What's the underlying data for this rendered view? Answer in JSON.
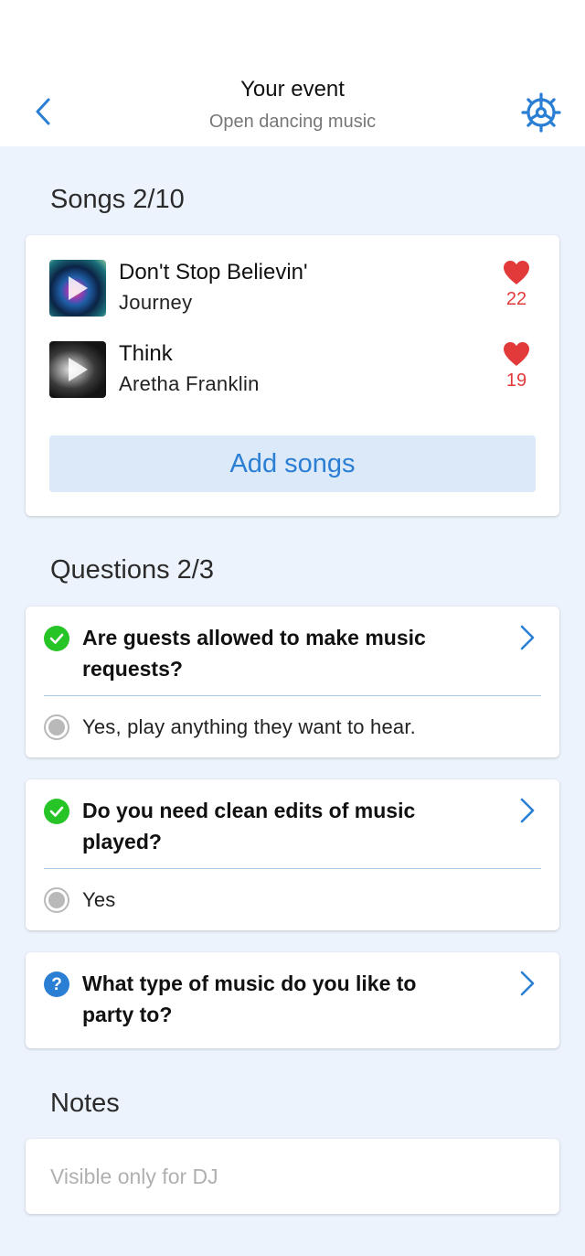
{
  "header": {
    "title": "Your event",
    "subtitle": "Open dancing music"
  },
  "songs_section": {
    "heading": "Songs 2/10",
    "songs": [
      {
        "title": "Don't Stop Believin'",
        "artist": "Journey",
        "likes": "22"
      },
      {
        "title": "Think",
        "artist": "Aretha Franklin",
        "likes": "19"
      }
    ],
    "add_button": "Add songs"
  },
  "questions_section": {
    "heading": "Questions 2/3",
    "questions": [
      {
        "line1": "Are guests allowed to make music",
        "line2": "requests?",
        "status": "answered",
        "answer": "Yes, play anything they want to hear."
      },
      {
        "line1": "Do you need clean edits of music",
        "line2": "played?",
        "status": "answered",
        "answer": "Yes"
      },
      {
        "line1": "What type of music do you like to",
        "line2": "party to?",
        "status": "unanswered"
      }
    ]
  },
  "notes_section": {
    "heading": "Notes",
    "placeholder": "Visible only for DJ"
  },
  "colors": {
    "accent": "#2a7fd4",
    "background": "#ecf3fc",
    "like": "#e23a3a",
    "answered": "#27c427",
    "unanswered": "#2a7fd4"
  },
  "icons": {
    "back": "chevron-left-icon",
    "settings": "gear-icon",
    "like": "heart-icon",
    "answered": "check-circle-icon",
    "unanswered": "question-circle-icon",
    "open": "chevron-right-icon"
  }
}
